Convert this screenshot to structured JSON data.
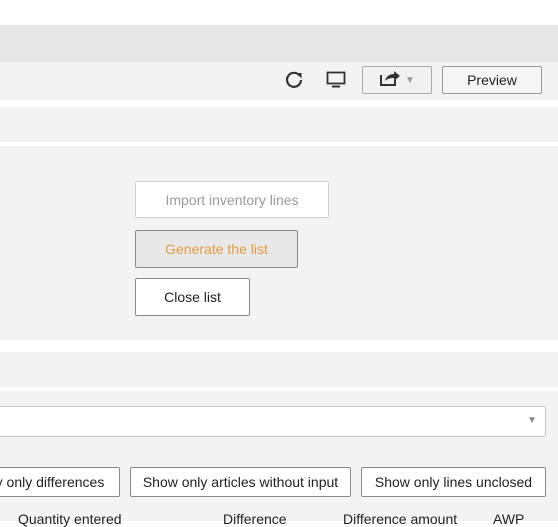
{
  "toolbar": {
    "refresh_icon": "refresh-icon",
    "monitor_icon": "monitor-icon",
    "share_icon": "share-icon",
    "preview_label": "Preview"
  },
  "actions": {
    "import_label": "Import inventory lines",
    "generate_label": "Generate the list",
    "close_label": "Close list"
  },
  "filter_select": {
    "selected": ""
  },
  "filters": {
    "only_differences": "y only differences",
    "without_input": "Show only articles without input",
    "lines_unclosed": "Show only lines unclosed"
  },
  "table": {
    "columns": [
      "Quantity entered",
      "Difference",
      "Difference amount",
      "AWP"
    ]
  },
  "colors": {
    "accent_orange": "#e89a3c",
    "panel_bg": "#f3f3f3",
    "band_bg": "#e6e6e6"
  }
}
